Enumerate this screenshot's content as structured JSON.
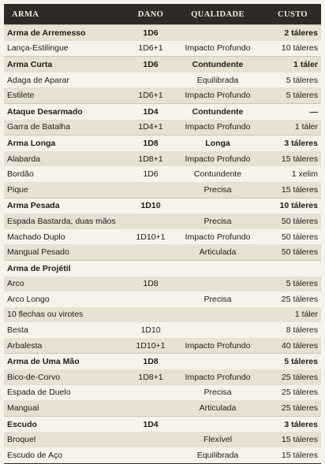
{
  "headers": [
    "ARMA",
    "DANO",
    "QUALIDADE",
    "CUSTO"
  ],
  "rows": [
    {
      "level": 0,
      "name": "Arma de Arremesso",
      "dano": "1D6",
      "qualidade": "",
      "custo": "2 táleres"
    },
    {
      "level": 1,
      "name": "Lança-Estilingue",
      "dano": "1D6+1",
      "qualidade": "Impacto Profundo",
      "custo": "10 táleres"
    },
    {
      "level": 0,
      "name": "Arma Curta",
      "dano": "1D6",
      "qualidade": "Contundente",
      "custo": "1 táler"
    },
    {
      "level": 1,
      "name": "Adaga de Aparar",
      "dano": "",
      "qualidade": "Equilibrada",
      "custo": "5 táleres"
    },
    {
      "level": 1,
      "name": "Estilete",
      "dano": "1D6+1",
      "qualidade": "Impacto Profundo",
      "custo": "5 táleres"
    },
    {
      "level": 0,
      "name": "Ataque Desarmado",
      "dano": "1D4",
      "qualidade": "Contundente",
      "custo": "—"
    },
    {
      "level": 1,
      "name": "Garra de Batalha",
      "dano": "1D4+1",
      "qualidade": "Impacto Profundo",
      "custo": "1 táler"
    },
    {
      "level": 0,
      "name": "Arma Longa",
      "dano": "1D8",
      "qualidade": "Longa",
      "custo": "3 táleres"
    },
    {
      "level": 1,
      "name": "Alabarda",
      "dano": "1D8+1",
      "qualidade": "Impacto Profundo",
      "custo": "15 táleres"
    },
    {
      "level": 1,
      "name": "Bordão",
      "dano": "1D6",
      "qualidade": "Contundente",
      "custo": "1 xelim"
    },
    {
      "level": 1,
      "name": "Pique",
      "dano": "",
      "qualidade": "Precisa",
      "custo": "15 táleres"
    },
    {
      "level": 0,
      "name": "Arma Pesada",
      "dano": "1D10",
      "qualidade": "",
      "custo": "10 táleres"
    },
    {
      "level": 1,
      "name": "Espada Bastarda, duas mãos",
      "dano": "",
      "qualidade": "Precisa",
      "custo": "50 táleres"
    },
    {
      "level": 1,
      "name": "Machado Duplo",
      "dano": "1D10+1",
      "qualidade": "Impacto Profundo",
      "custo": "50 táleres"
    },
    {
      "level": 1,
      "name": "Mangual Pesado",
      "dano": "",
      "qualidade": "Articulada",
      "custo": "50 táleres"
    },
    {
      "level": 0,
      "name": "Arma de Projétil",
      "dano": "",
      "qualidade": "",
      "custo": ""
    },
    {
      "level": 1,
      "name": "Arco",
      "dano": "1D8",
      "qualidade": "",
      "custo": "5 táleres"
    },
    {
      "level": 2,
      "name": "Arco Longo",
      "dano": "",
      "qualidade": "Precisa",
      "custo": "25 táleres"
    },
    {
      "level": 2,
      "name": "10 flechas ou virotes",
      "dano": "",
      "qualidade": "",
      "custo": "1 táler"
    },
    {
      "level": 1,
      "name": "Besta",
      "dano": "1D10",
      "qualidade": "",
      "custo": "8 táleres"
    },
    {
      "level": 2,
      "name": "Arbalesta",
      "dano": "1D10+1",
      "qualidade": "Impacto Profundo",
      "custo": "40 táleres"
    },
    {
      "level": 0,
      "name": "Arma de Uma Mão",
      "dano": "1D8",
      "qualidade": "",
      "custo": "5 táleres"
    },
    {
      "level": 1,
      "name": "Bico-de-Corvo",
      "dano": "1D8+1",
      "qualidade": "Impacto Profundo",
      "custo": "25 táleres"
    },
    {
      "level": 1,
      "name": "Espada de Duelo",
      "dano": "",
      "qualidade": "Precisa",
      "custo": "25 táleres"
    },
    {
      "level": 1,
      "name": "Mangual",
      "dano": "",
      "qualidade": "Articulada",
      "custo": "25 táleres"
    },
    {
      "level": 0,
      "name": "Escudo",
      "dano": "1D4",
      "qualidade": "",
      "custo": "3 táleres"
    },
    {
      "level": 1,
      "name": "Broquel",
      "dano": "",
      "qualidade": "Flexível",
      "custo": "15 táleres"
    },
    {
      "level": 1,
      "name": "Escudo de Aço",
      "dano": "",
      "qualidade": "Equilibrada",
      "custo": "15 táleres"
    }
  ]
}
